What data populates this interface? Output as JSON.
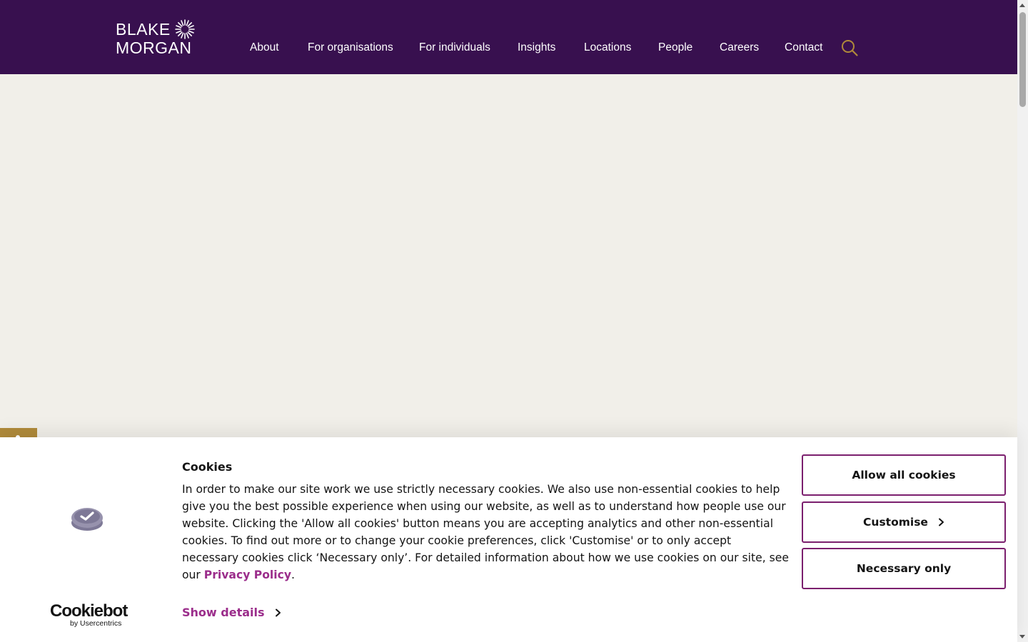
{
  "logo": {
    "line1": "BLAKE",
    "line2": "MORGAN"
  },
  "nav": {
    "items": [
      {
        "label": "About"
      },
      {
        "label": "For organisations"
      },
      {
        "label": "For individuals"
      },
      {
        "label": "Insights"
      },
      {
        "label": "Locations"
      },
      {
        "label": "People"
      },
      {
        "label": "Careers"
      },
      {
        "label": "Contact"
      }
    ],
    "search_icon": "search-icon"
  },
  "colors": {
    "header_bg": "#38104f",
    "page_bg": "#f1efe9",
    "accent_gold": "#b08a3a",
    "link_purple": "#9b2d8b",
    "button_border": "#7b1f6e"
  },
  "cookie_banner": {
    "title": "Cookies",
    "body": "In order to make our site work we use strictly necessary cookies. We also use non-essential cookies to help give you the best possible experience when using our website, as well as to understand how people use our website. Clicking the 'Allow all cookies' button means you are accepting analytics and other non-essential cookies. To find out more or to change your cookie preferences, click 'Customise' or to only accept necessary cookies click ‘Necessary only’. For detailed information about how we use cookies on our site, see our ",
    "privacy_link": "Privacy Policy",
    "body_end": ".",
    "show_details": "Show details",
    "buttons": {
      "allow_all": "Allow all cookies",
      "customise": "Customise",
      "necessary_only": "Necessary only"
    },
    "provider": {
      "name": "Cookiebot",
      "sub": "by Usercentrics"
    }
  }
}
